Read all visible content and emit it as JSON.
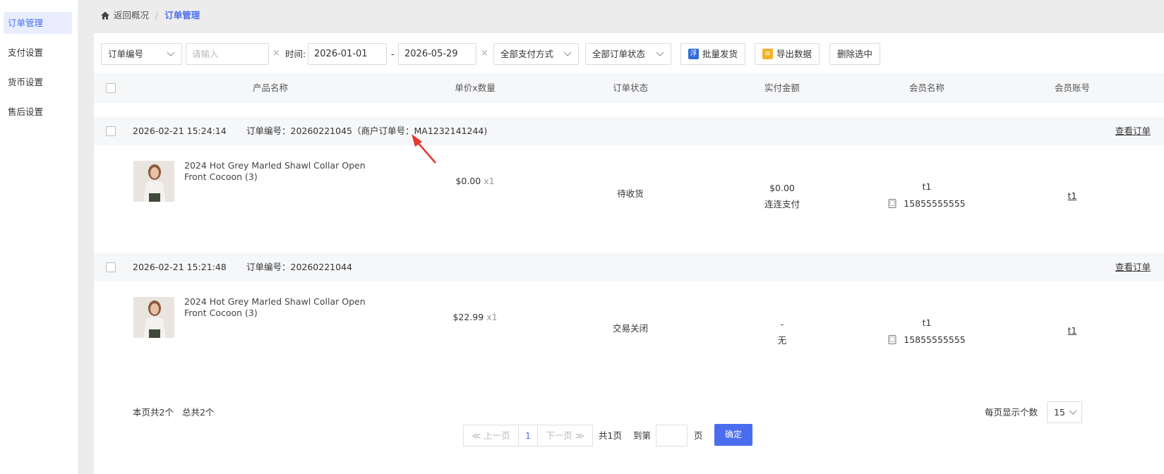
{
  "sidebar": {
    "items": [
      {
        "label": "订单管理",
        "active": true
      },
      {
        "label": "支付设置"
      },
      {
        "label": "货币设置"
      },
      {
        "label": "售后设置"
      }
    ]
  },
  "breadcrumb": {
    "back_label": "返回概况",
    "separator": "/",
    "current": "订单管理"
  },
  "toolbar": {
    "search_field_select": "订单编号",
    "search_placeholder": "请输入",
    "clear_symbol": "×",
    "time_label": "时间:",
    "date_start": "2026-01-01",
    "date_dash": "-",
    "date_end": "2026-05-29",
    "payment_select": "全部支付方式",
    "status_select": "全部订单状态",
    "batch_ship_label": "批量发货",
    "export_label": "导出数据",
    "delete_selected_label": "删除选中",
    "colors": {
      "batch_icon": "#2f6bd8",
      "export_icon": "#f2b32a"
    }
  },
  "table": {
    "headers": [
      "产品名称",
      "单价x数量",
      "订单状态",
      "实付金额",
      "会员名称",
      "会员账号"
    ]
  },
  "orders": [
    {
      "time": "2026-02-21 15:24:14",
      "order_no": "订单编号：20260221045（商户订单号：MA1232141244)",
      "view_label": "查看订单",
      "product_name": "2024 Hot Grey Marled Shawl Collar Open Front Cocoon (3)",
      "price": "$0.00",
      "qty": "x1",
      "status": "待收货",
      "paid_amount": "$0.00",
      "payment_method": "连连支付",
      "member_name": "t1",
      "member_phone": "15855555555",
      "member_account": "t1"
    },
    {
      "time": "2026-02-21 15:21:48",
      "order_no": "订单编号：20260221044",
      "view_label": "查看订单",
      "product_name": "2024 Hot Grey Marled Shawl Collar Open Front Cocoon (3)",
      "price": "$22.99",
      "qty": "x1",
      "status": "交易关闭",
      "paid_amount": "-",
      "payment_method": "无",
      "member_name": "t1",
      "member_phone": "15855555555",
      "member_account": "t1"
    }
  ],
  "pagination": {
    "page_count_text": "本页共2个",
    "total_text": "总共2个",
    "per_page_label": "每页显示个数",
    "per_page_value": "15",
    "prev_label": "≪ 上一页",
    "current_page": "1",
    "next_label": "下一页 ≫",
    "total_pages": "共1页",
    "goto_label": "到第",
    "page_unit": "页",
    "confirm_label": "确定"
  },
  "colors": {
    "accent": "#4a6df0",
    "annotation_arrow": "#e8372f"
  }
}
